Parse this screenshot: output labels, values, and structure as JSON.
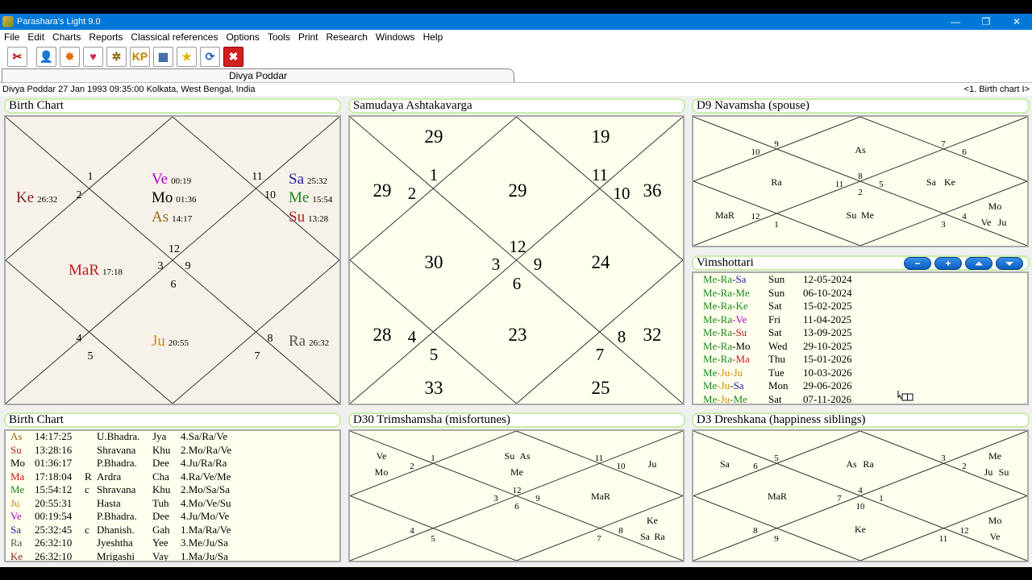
{
  "app": {
    "title": "Parashara's Light 9.0",
    "minimize": "—",
    "restore": "❐",
    "close": "✕"
  },
  "menu": [
    "File",
    "Edit",
    "Charts",
    "Reports",
    "Classical references",
    "Options",
    "Tools",
    "Print",
    "Research",
    "Windows",
    "Help"
  ],
  "toolbar": [
    {
      "name": "tools-icon",
      "glyph": "✂",
      "color": "#c00000"
    },
    {
      "name": "person-icon",
      "glyph": "👤",
      "color": "#5a3a10"
    },
    {
      "name": "sun-icon",
      "glyph": "✸",
      "color": "#e07000"
    },
    {
      "name": "heart-icon",
      "glyph": "♥",
      "color": "#d02040"
    },
    {
      "name": "wheel-icon",
      "glyph": "✲",
      "color": "#8a5a00"
    },
    {
      "name": "kp-icon",
      "glyph": "KP",
      "color": "#c08000"
    },
    {
      "name": "chart-icon",
      "glyph": "▦",
      "color": "#3060a0"
    },
    {
      "name": "star-icon",
      "glyph": "★",
      "color": "#e0b000"
    },
    {
      "name": "refresh-icon",
      "glyph": "⟳",
      "color": "#2060c0"
    },
    {
      "name": "close-red-icon",
      "glyph": "✖",
      "color": "#ffffff"
    }
  ],
  "tab": {
    "label": "Divya Poddar"
  },
  "info": {
    "left": "Divya Poddar 27 Jan 1993 09:35:00  Kolkata, West Bengal, India",
    "right": "<1. Birth chart I>"
  },
  "panels": {
    "birth_chart": {
      "title": "Birth Chart",
      "nums": [
        "1",
        "2",
        "12",
        "3",
        "9",
        "11",
        "10",
        "6",
        "4",
        "5",
        "8",
        "7"
      ],
      "planets": [
        {
          "name": "Ke",
          "deg": "26:32",
          "color": "#8b1a1a"
        },
        {
          "name": "Ve",
          "deg": "00:19",
          "color": "#b000d0"
        },
        {
          "name": "Mo",
          "deg": "01:36",
          "color": "#000000"
        },
        {
          "name": "As",
          "deg": "14:17",
          "color": "#9a6a1a"
        },
        {
          "name": "Sa",
          "deg": "25:32",
          "color": "#1a1aa0"
        },
        {
          "name": "Me",
          "deg": "15:54",
          "color": "#1a8a1a"
        },
        {
          "name": "Su",
          "deg": "13:28",
          "color": "#b01a1a"
        },
        {
          "name": "MaR",
          "deg": "17:18",
          "color": "#c01a1a"
        },
        {
          "name": "Ju",
          "deg": "20:55",
          "color": "#d08a00"
        },
        {
          "name": "Ra",
          "deg": "26:32",
          "color": "#555555"
        }
      ]
    },
    "ashtakavarga": {
      "title": "Samudaya Ashtakavarga",
      "nums": [
        "1",
        "2",
        "12",
        "3",
        "6",
        "9",
        "11",
        "10",
        "4",
        "5",
        "8",
        "7"
      ],
      "points": [
        {
          "v": "29",
          "color": "#000000"
        },
        {
          "v": "19",
          "color": "#8b0000"
        },
        {
          "v": "29",
          "color": "#000000"
        },
        {
          "v": "29",
          "color": "#000000"
        },
        {
          "v": "36",
          "color": "#000000"
        },
        {
          "v": "30",
          "color": "#000000"
        },
        {
          "v": "24",
          "color": "#8b0000"
        },
        {
          "v": "28",
          "color": "#000000"
        },
        {
          "v": "23",
          "color": "#8b0000"
        },
        {
          "v": "32",
          "color": "#000000"
        },
        {
          "v": "33",
          "color": "#000000"
        },
        {
          "v": "25",
          "color": "#000000"
        }
      ]
    },
    "d9": {
      "title": "D9 Navamsha  (spouse)",
      "nums": [
        "9",
        "10",
        "7",
        "6",
        "8",
        "11",
        "2",
        "5",
        "12",
        "1",
        "4",
        "3"
      ],
      "labels": [
        {
          "t": "As",
          "color": "#9a6a1a"
        },
        {
          "t": "Ra",
          "color": "#555555"
        },
        {
          "t": "Sa",
          "color": "#1a1aa0"
        },
        {
          "t": "Ke",
          "color": "#8b1a1a"
        },
        {
          "t": "Mo",
          "color": "#000000"
        },
        {
          "t": "MaR",
          "color": "#c01a1a"
        },
        {
          "t": "Su",
          "color": "#b01a1a"
        },
        {
          "t": "Me",
          "color": "#1a8a1a"
        },
        {
          "t": "Ve",
          "color": "#b000d0"
        },
        {
          "t": "Ju",
          "color": "#d08a00"
        }
      ]
    },
    "vimshottari": {
      "title": "Vimshottari",
      "buttons": [
        "−",
        "+",
        "⏶",
        "⏷"
      ],
      "rows": [
        {
          "p": [
            {
              "t": "Me",
              "c": "#1a8a1a"
            },
            {
              "t": "-Ra",
              "c": "#1a8a1a"
            },
            {
              "t": "-Sa",
              "c": "#1a1aa0"
            }
          ],
          "day": "Sun",
          "date": "12-05-2024"
        },
        {
          "p": [
            {
              "t": "Me",
              "c": "#1a8a1a"
            },
            {
              "t": "-Ra",
              "c": "#1a8a1a"
            },
            {
              "t": "-Me",
              "c": "#1a8a1a"
            }
          ],
          "day": "Sun",
          "date": "06-10-2024"
        },
        {
          "p": [
            {
              "t": "Me",
              "c": "#1a8a1a"
            },
            {
              "t": "-Ra",
              "c": "#1a8a1a"
            },
            {
              "t": "-Ke",
              "c": "#1a8a1a"
            }
          ],
          "day": "Sat",
          "date": "15-02-2025"
        },
        {
          "p": [
            {
              "t": "Me",
              "c": "#1a8a1a"
            },
            {
              "t": "-Ra",
              "c": "#1a8a1a"
            },
            {
              "t": "-Ve",
              "c": "#b000d0"
            }
          ],
          "day": "Fri",
          "date": "11-04-2025"
        },
        {
          "p": [
            {
              "t": "Me",
              "c": "#1a8a1a"
            },
            {
              "t": "-Ra",
              "c": "#1a8a1a"
            },
            {
              "t": "-Su",
              "c": "#b01a1a"
            }
          ],
          "day": "Sat",
          "date": "13-09-2025"
        },
        {
          "p": [
            {
              "t": "Me",
              "c": "#1a8a1a"
            },
            {
              "t": "-Ra",
              "c": "#1a8a1a"
            },
            {
              "t": "-Mo",
              "c": "#000000"
            }
          ],
          "day": "Wed",
          "date": "29-10-2025"
        },
        {
          "p": [
            {
              "t": "Me",
              "c": "#1a8a1a"
            },
            {
              "t": "-Ra",
              "c": "#1a8a1a"
            },
            {
              "t": "-Ma",
              "c": "#c01a1a"
            }
          ],
          "day": "Thu",
          "date": "15-01-2026"
        },
        {
          "p": [
            {
              "t": "Me",
              "c": "#1a8a1a"
            },
            {
              "t": "-Ju",
              "c": "#d08a00"
            },
            {
              "t": "-Ju",
              "c": "#d08a00"
            }
          ],
          "day": "Tue",
          "date": "10-03-2026"
        },
        {
          "p": [
            {
              "t": "Me",
              "c": "#1a8a1a"
            },
            {
              "t": "-Ju",
              "c": "#d08a00"
            },
            {
              "t": "-Sa",
              "c": "#1a1aa0"
            }
          ],
          "day": "Mon",
          "date": "29-06-2026"
        },
        {
          "p": [
            {
              "t": "Me",
              "c": "#1a8a1a"
            },
            {
              "t": "-Ju",
              "c": "#d08a00"
            },
            {
              "t": "-Me",
              "c": "#1a8a1a"
            }
          ],
          "day": "Sat",
          "date": "07-11-2026"
        }
      ]
    },
    "birth_table": {
      "title": "Birth Chart",
      "rows": [
        {
          "p": "As",
          "c": "#9a6a1a",
          "deg": "14:17:25",
          "r": "",
          "nak": "U.Bhadra.",
          "ab": "Jya",
          "pada": "4.Sa/Ra/Ve"
        },
        {
          "p": "Su",
          "c": "#b01a1a",
          "deg": "13:28:16",
          "r": "",
          "nak": "Shravana",
          "ab": "Khu",
          "pada": "2.Mo/Ra/Ve"
        },
        {
          "p": "Mo",
          "c": "#000000",
          "deg": "01:36:17",
          "r": "",
          "nak": "P.Bhadra.",
          "ab": "Dee",
          "pada": "4.Ju/Ra/Ra"
        },
        {
          "p": "Ma",
          "c": "#c01a1a",
          "deg": "17:18:04",
          "r": "R",
          "nak": "Ardra",
          "ab": "Cha",
          "pada": "4.Ra/Ve/Me"
        },
        {
          "p": "Me",
          "c": "#1a8a1a",
          "deg": "15:54:12",
          "r": "c",
          "nak": "Shravana",
          "ab": "Khu",
          "pada": "2.Mo/Sa/Sa"
        },
        {
          "p": "Ju",
          "c": "#d08a00",
          "deg": "20:55:31",
          "r": "",
          "nak": "Hasta",
          "ab": "Tuh",
          "pada": "4.Mo/Ve/Su"
        },
        {
          "p": "Ve",
          "c": "#b000d0",
          "deg": "00:19:54",
          "r": "",
          "nak": "P.Bhadra.",
          "ab": "Dee",
          "pada": "4.Ju/Mo/Ve"
        },
        {
          "p": "Sa",
          "c": "#1a1aa0",
          "deg": "25:32:45",
          "r": "c",
          "nak": "Dhanish.",
          "ab": "Gah",
          "pada": "1.Ma/Ra/Ve"
        },
        {
          "p": "Ra",
          "c": "#555555",
          "deg": "26:32:10",
          "r": "",
          "nak": "Jyeshtha",
          "ab": "Yee",
          "pada": "3.Me/Ju/Sa"
        },
        {
          "p": "Ke",
          "c": "#8b1a1a",
          "deg": "26:32:10",
          "r": "",
          "nak": "Mrigashi",
          "ab": "Vay",
          "pada": "1.Ma/Ju/Sa"
        }
      ]
    },
    "d30": {
      "title": "D30 Trimshamsha  (misfortunes)",
      "nums": [
        "1",
        "2",
        "11",
        "10",
        "12",
        "3",
        "9",
        "6",
        "4",
        "5",
        "8",
        "7"
      ],
      "labels": [
        {
          "t": "Ve",
          "color": "#b000d0"
        },
        {
          "t": "Mo",
          "color": "#000000"
        },
        {
          "t": "Su",
          "color": "#b01a1a"
        },
        {
          "t": "As",
          "color": "#9a6a1a"
        },
        {
          "t": "Me",
          "color": "#1a8a1a"
        },
        {
          "t": "Ju",
          "color": "#d08a00"
        },
        {
          "t": "MaR",
          "color": "#c01a1a"
        },
        {
          "t": "Ke",
          "color": "#8b1a1a"
        },
        {
          "t": "Sa",
          "color": "#1a1aa0"
        },
        {
          "t": "Ra",
          "color": "#555555"
        }
      ]
    },
    "d3": {
      "title": "D3 Dreshkana  (happiness siblings)",
      "nums": [
        "5",
        "6",
        "3",
        "2",
        "4",
        "7",
        "1",
        "10",
        "8",
        "9",
        "12",
        "11"
      ],
      "labels": [
        {
          "t": "Sa",
          "color": "#1a1aa0"
        },
        {
          "t": "As",
          "color": "#9a6a1a"
        },
        {
          "t": "Ra",
          "color": "#555555"
        },
        {
          "t": "Me",
          "color": "#1a8a1a"
        },
        {
          "t": "Ju",
          "color": "#d08a00"
        },
        {
          "t": "Su",
          "color": "#b01a1a"
        },
        {
          "t": "MaR",
          "color": "#c01a1a"
        },
        {
          "t": "Ke",
          "color": "#8b1a1a"
        },
        {
          "t": "Mo",
          "color": "#000000"
        },
        {
          "t": "Ve",
          "color": "#b000d0"
        }
      ]
    }
  }
}
